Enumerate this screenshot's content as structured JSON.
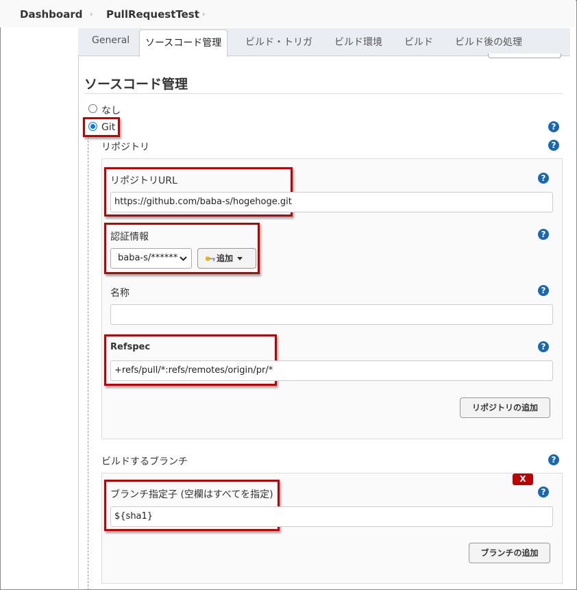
{
  "breadcrumb": {
    "items": [
      "Dashboard",
      "PullRequestTest"
    ],
    "separator": "›"
  },
  "tabs": [
    "General",
    "ソースコード管理",
    "ビルド・トリガ",
    "ビルド環境",
    "ビルド",
    "ビルド後の処理"
  ],
  "active_tab": "ソースコード管理",
  "section": {
    "title": "ソースコード管理"
  },
  "scm": {
    "option_none": "なし",
    "option_git": "Git",
    "selected": "Git"
  },
  "repository": {
    "heading": "リポジトリ",
    "url_label": "リポジトリURL",
    "url_value": "https://github.com/baba-s/hogehoge.git",
    "credentials_label": "認証情報",
    "credentials_value": "baba-s/******",
    "add_button": "追加",
    "name_label": "名称",
    "name_value": "",
    "refspec_label": "Refspec",
    "refspec_value": "+refs/pull/*:refs/remotes/origin/pr/*",
    "add_repo_button": "リポジトリの追加"
  },
  "branches": {
    "heading": "ビルドするブランチ",
    "remove_button": "X",
    "specifier_label": "ブランチ指定子 (空欄はすべてを指定)",
    "specifier_value": "${sha1}",
    "add_branch_button": "ブランチの追加"
  },
  "help_glyph": "?",
  "colors": {
    "highlight": "#c00000",
    "help": "#1668b5",
    "radio": "#0075ff"
  }
}
